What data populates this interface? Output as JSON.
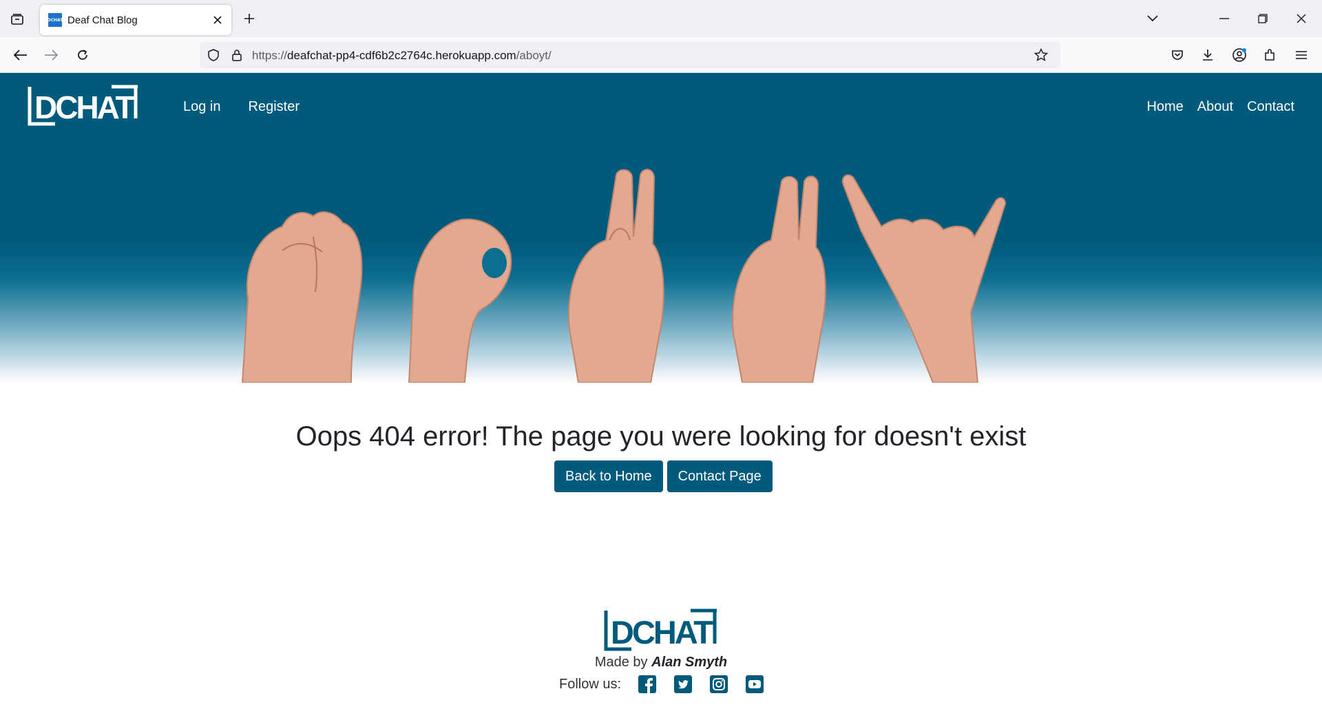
{
  "browser": {
    "tab_title": "Deaf Chat Blog",
    "favicon_text": "DCHAT",
    "url_prefix": "https://",
    "url_host": "deafchat-pp4-cdf6b2c2764c.herokuapp.com",
    "url_path": "/aboyt/"
  },
  "site": {
    "logo_text": "DCHAT",
    "nav_left": [
      "Log in",
      "Register"
    ],
    "nav_right": [
      "Home",
      "About",
      "Contact"
    ],
    "hero_alt": "Hands spelling DCHAT in sign language"
  },
  "main": {
    "error_message": "Oops 404 error! The page you were looking for doesn't exist",
    "buttons": [
      "Back to Home",
      "Contact Page"
    ]
  },
  "footer": {
    "logo_text": "DCHAT",
    "made_by_prefix": "Made by",
    "author": "Alan Smyth",
    "follow_label": "Follow us:",
    "social_icons": [
      "facebook-icon",
      "twitter-icon",
      "instagram-icon",
      "youtube-icon"
    ]
  },
  "colors": {
    "brand": "#005a7c",
    "white": "#ffffff",
    "text": "#212529"
  }
}
